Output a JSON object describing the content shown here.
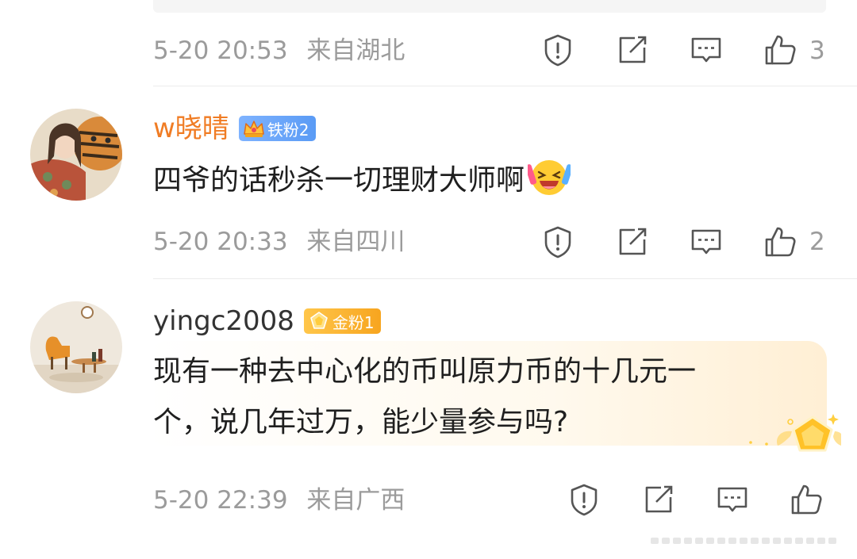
{
  "comments": [
    {
      "meta": {
        "date": "5-20",
        "time": "20:53",
        "location": "来自湖北"
      },
      "likes": "3"
    },
    {
      "user": {
        "name": "w晓晴",
        "badge": "铁粉2",
        "name_color": "#f07c24"
      },
      "text": "四爷的话秒杀一切理财大师啊",
      "meta": {
        "date": "5-20",
        "time": "20:33",
        "location": "来自四川"
      },
      "likes": "2"
    },
    {
      "user": {
        "name": "yingc2008",
        "badge": "金粉1",
        "name_color": "#333333"
      },
      "text_line1": "现有一种去中心化的币叫原力币的十几元一",
      "text_line2": "个，说几年过万，能少量参与吗?",
      "meta": {
        "date": "5-20",
        "time": "22:39",
        "location": "来自广西"
      },
      "likes": ""
    }
  ],
  "icons": [
    "report-icon",
    "share-icon",
    "comment-icon",
    "like-icon",
    "crown-icon",
    "laugh-emoji-icon",
    "gold-medal-icon"
  ],
  "colors": {
    "meta_gray": "#9b9b9b",
    "divider": "#ececec",
    "iron_badge": "#6aa7fa",
    "gold_badge": "#f7a51f"
  }
}
